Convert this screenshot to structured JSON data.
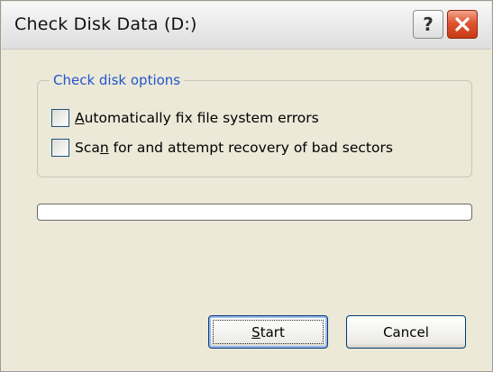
{
  "window": {
    "title": "Check Disk Data (D:)",
    "help_glyph": "?"
  },
  "options_group": {
    "label": "Check disk options",
    "options": [
      {
        "pre": "",
        "accel": "A",
        "post": "utomatically fix file system errors",
        "checked": false
      },
      {
        "pre": "Sca",
        "accel": "n",
        "post": " for and attempt recovery of bad sectors",
        "checked": false
      }
    ]
  },
  "progress": {
    "fraction": 0
  },
  "buttons": {
    "start": {
      "pre": "",
      "accel": "S",
      "post": "tart"
    },
    "cancel": {
      "label": "Cancel"
    }
  }
}
